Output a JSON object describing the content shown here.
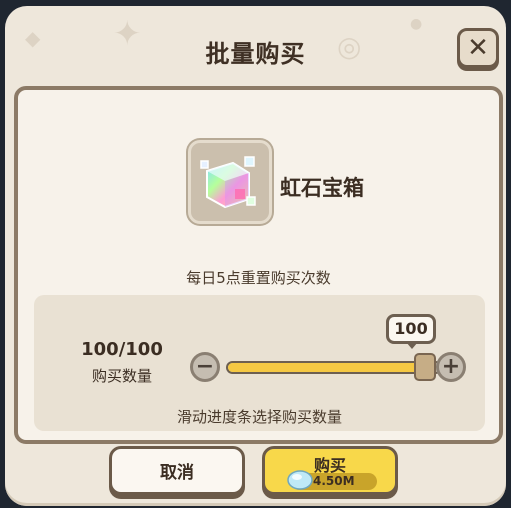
{
  "dialog": {
    "title": "批量购买",
    "close_icon": "close-x-icon"
  },
  "item": {
    "name": "虹石宝箱",
    "icon": "rainbow-gem-chest-icon",
    "reset_note": "每日5点重置购买次数"
  },
  "quantity": {
    "value_text": "100/100",
    "label": "购买数量",
    "slider_bubble": "100",
    "slider_fraction": 1.0,
    "hint": "滑动进度条选择购买数量"
  },
  "buttons": {
    "cancel_label": "取消",
    "buy_label": "购买",
    "price": "4.50M",
    "currency_icon": "blue-gem-currency-icon"
  },
  "colors": {
    "accent_yellow": "#f8d84a",
    "border_brown": "#6b5a49",
    "panel_bg": "#f7f2ea"
  }
}
